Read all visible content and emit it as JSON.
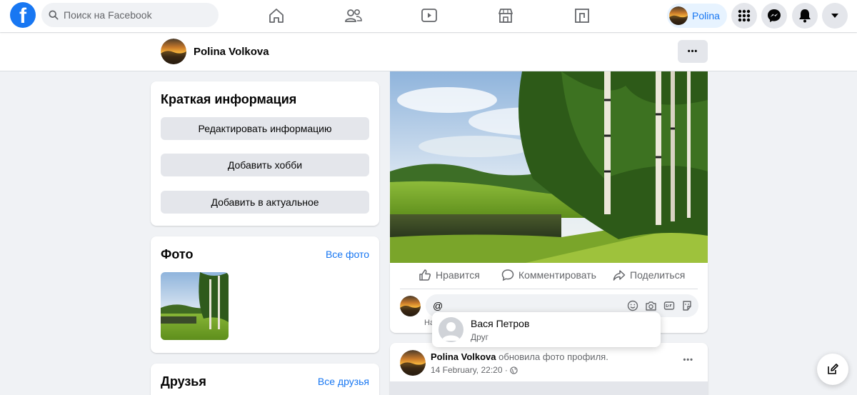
{
  "topbar": {
    "logo": "f",
    "search_placeholder": "Поиск на Facebook",
    "nav_icons": [
      "home-icon",
      "friends-icon",
      "watch-icon",
      "marketplace-icon",
      "gaming-icon"
    ],
    "profile_name": "Polina",
    "accent": "#1877f2"
  },
  "subheader": {
    "name": "Polina Volkova",
    "more_label": "•••"
  },
  "intro": {
    "title": "Краткая информация",
    "buttons": [
      "Редактировать информацию",
      "Добавить хобби",
      "Добавить в актуальное"
    ]
  },
  "photos": {
    "title": "Фото",
    "link": "Все фото"
  },
  "friends": {
    "title": "Друзья",
    "link": "Все друзья"
  },
  "post": {
    "actions": [
      "Нравится",
      "Комментировать",
      "Поделиться"
    ],
    "comment_value": "@",
    "comment_hint": "На"
  },
  "mention_suggestion": {
    "name": "Вася Петров",
    "role": "Друг"
  },
  "post2": {
    "author": "Polina Volkova",
    "action_text": "обновила фото профиля.",
    "date": "14 February, 22:20 ·",
    "more_label": "•••"
  }
}
